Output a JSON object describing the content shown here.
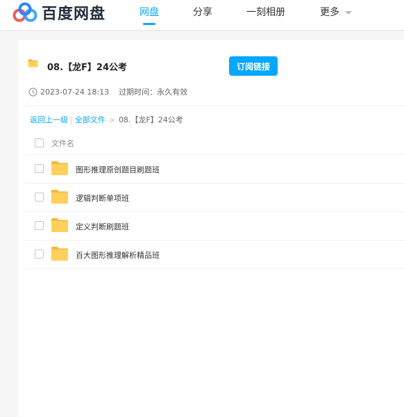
{
  "header": {
    "brand": "百度网盘",
    "nav": [
      {
        "label": "网盘",
        "active": true
      },
      {
        "label": "分享",
        "active": false
      },
      {
        "label": "一刻相册",
        "active": false
      },
      {
        "label": "更多",
        "active": false
      }
    ]
  },
  "share": {
    "title": "08.【龙F】24公考",
    "subscribe_label": "订阅链接",
    "date": "2023-07-24 18:13",
    "expiry_label": "过期时间：永久有效"
  },
  "breadcrumb": {
    "back": "返回上一级",
    "all": "全部文件",
    "current": "08.【龙F】24公考"
  },
  "file_list": {
    "column_header": "文件名",
    "items": [
      {
        "name": "图形推理原创题目刷题班",
        "icon": "folder-icon"
      },
      {
        "name": "逻辑判断单项班",
        "icon": "folder-icon"
      },
      {
        "name": "定义判断刷题班",
        "icon": "folder-icon"
      },
      {
        "name": "百大图形推理解析精品班",
        "icon": "folder-icon"
      }
    ]
  },
  "colors": {
    "accent": "#06a7ff",
    "folder": "#ffd05a",
    "background": "#f7f7f7"
  }
}
